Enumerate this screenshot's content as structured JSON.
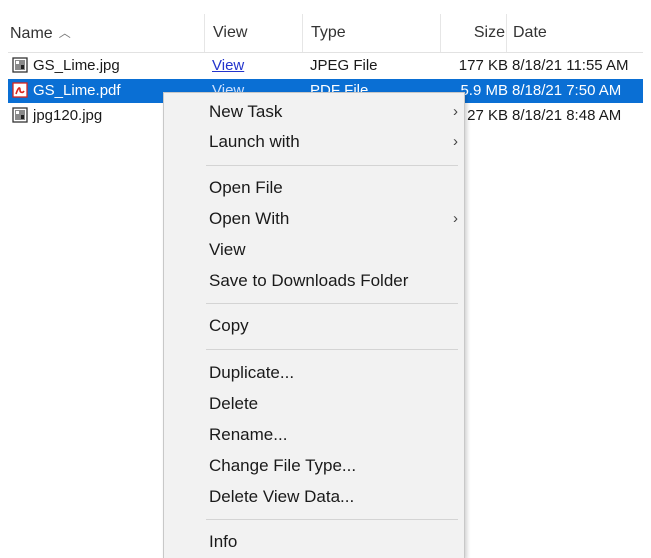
{
  "columns": {
    "name": "Name",
    "view": "View",
    "type": "Type",
    "size": "Size",
    "date": "Date"
  },
  "files": [
    {
      "name": "GS_Lime.jpg",
      "view": "View",
      "type": "JPEG File",
      "size": "177 KB",
      "date": "8/18/21 11:55 AM",
      "icon": "image-file-icon",
      "selected": false
    },
    {
      "name": "GS_Lime.pdf",
      "view": "View",
      "type": "PDF File",
      "size": "5.9 MB",
      "date": "8/18/21 7:50 AM",
      "icon": "pdf-file-icon",
      "selected": true
    },
    {
      "name": "jpg120.jpg",
      "view": "",
      "type": "",
      "size": "27 KB",
      "date": "8/18/21 8:48 AM",
      "icon": "image-file-icon",
      "selected": false
    }
  ],
  "context_menu": {
    "items": [
      {
        "label": "New Task",
        "submenu": true
      },
      {
        "label": "Launch with",
        "submenu": true
      },
      {
        "label": "Open File",
        "submenu": false
      },
      {
        "label": "Open With",
        "submenu": true
      },
      {
        "label": "View",
        "submenu": false
      },
      {
        "label": "Save to Downloads Folder",
        "submenu": false
      },
      {
        "label": "Copy",
        "submenu": false
      },
      {
        "label": "Duplicate...",
        "submenu": false
      },
      {
        "label": "Delete",
        "submenu": false
      },
      {
        "label": "Rename...",
        "submenu": false
      },
      {
        "label": "Change File Type...",
        "submenu": false
      },
      {
        "label": "Delete View Data...",
        "submenu": false
      },
      {
        "label": "Info",
        "submenu": false
      }
    ],
    "submenu_glyph": "›"
  },
  "colors": {
    "selection": "#0a6fd4",
    "link": "#2233cc",
    "menu_bg": "#f2f2f2",
    "pdf_icon": "#d9251c"
  }
}
